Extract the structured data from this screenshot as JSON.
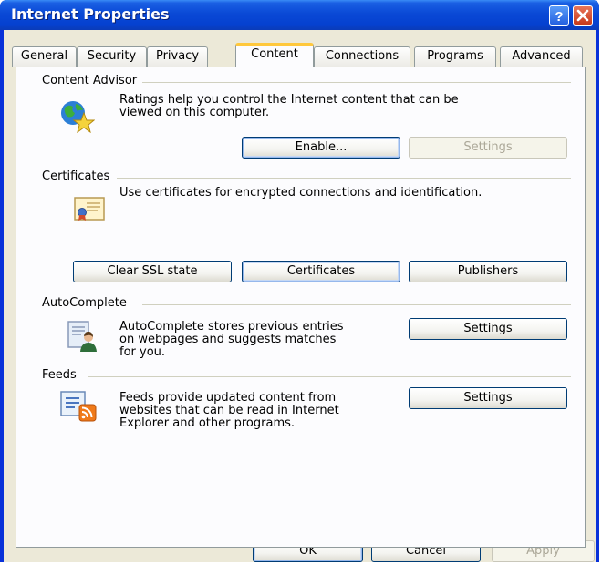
{
  "window": {
    "title": "Internet Properties"
  },
  "tabs": [
    "General",
    "Security",
    "Privacy",
    "Content",
    "Connections",
    "Programs",
    "Advanced"
  ],
  "active_tab": "Content",
  "content_advisor": {
    "title": "Content Advisor",
    "description_line1": "Ratings help you control the Internet content that can be",
    "description_line2": "viewed on this computer.",
    "enable_label": "Enable...",
    "settings_label": "Settings"
  },
  "certificates": {
    "title": "Certificates",
    "description": "Use certificates for encrypted connections and identification.",
    "clear_ssl_label": "Clear SSL state",
    "certificates_label": "Certificates",
    "publishers_label": "Publishers"
  },
  "autocomplete": {
    "title": "AutoComplete",
    "description_line1": "AutoComplete stores previous entries",
    "description_line2": "on webpages and suggests matches",
    "description_line3": "for you.",
    "settings_label": "Settings"
  },
  "feeds": {
    "title": "Feeds",
    "description_line1": "Feeds provide updated content from",
    "description_line2": "websites that can be read in Internet",
    "description_line3": "Explorer and other programs.",
    "settings_label": "Settings"
  },
  "footer": {
    "ok_label": "OK",
    "cancel_label": "Cancel",
    "apply_label": "Apply"
  },
  "icons": {
    "help": "help-icon",
    "close": "close-icon",
    "content_advisor": "globe-star-icon",
    "certificate": "certificate-icon",
    "autocomplete": "autocomplete-icon",
    "feeds": "feeds-icon"
  },
  "colors": {
    "title_bar": "#0a49d6",
    "tab_highlight": "#ffc83c",
    "dialog_bg": "#ece9d8",
    "button_border": "#003c74"
  }
}
